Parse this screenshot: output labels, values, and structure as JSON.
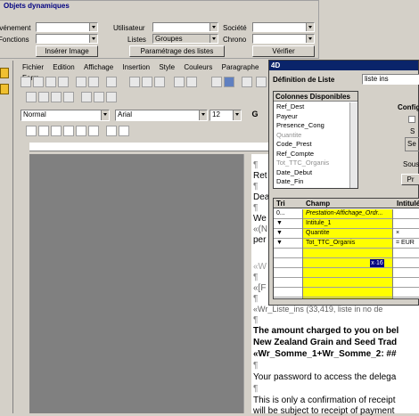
{
  "panel": {
    "title": "Objets dynamiques",
    "evenement_label": "Événement",
    "utilisateur_label": "Utilisateur",
    "societe_label": "Société",
    "fonctions_label": "Fonctions",
    "listes_label": "Listes",
    "listes_value": "Groupes",
    "chrono_label": "Chrono",
    "inserer_image": "Insérer Image",
    "parametrage": "Paramétrage des listes",
    "verifier": "Vérifier"
  },
  "menu": [
    "Fichier",
    "Edition",
    "Affichage",
    "Insertion",
    "Style",
    "Couleurs",
    "Paragraphe",
    "Form"
  ],
  "format": {
    "style": "Normal",
    "font": "Arial",
    "size": "12",
    "bold": "G"
  },
  "document": {
    "lines": [
      "Ret",
      "Dea",
      "We",
      "«(N",
      "per",
      "«W",
      "«[F",
      "«Wr_Liste_ins (33,419, liste in no de",
      "The amount charged to you on bel",
      "New Zealand Grain and Seed Trad",
      "«Wr_Somme_1+Wr_Somme_2: ##",
      "Your password to access the delega",
      "This is only a confirmation of receipt",
      "will be subject to receipt of payment"
    ],
    "pilcrow": "¶"
  },
  "dialog": {
    "icon": "4D",
    "title": "Définition de Liste",
    "name_label": "Définition de Liste",
    "name_value": "liste ins",
    "config_label": "Configu",
    "s_label": "S",
    "se_label": "Se",
    "sous_label": "Sous",
    "pr_label": "Pr",
    "columns_header": "Colonnes Disponibles",
    "columns": [
      "Ref_Dest",
      "Payeur",
      "Presence_Cong",
      "Quantite",
      "Code_Prest",
      "Ref_Compte",
      "Tot_TTC_Organis",
      "Date_Debut",
      "Date_Fin"
    ],
    "columns_disabled": [
      false,
      false,
      false,
      true,
      false,
      false,
      true,
      false,
      false
    ],
    "table_headers": [
      "Tri",
      "Champ",
      "Intitulé"
    ],
    "rows": [
      {
        "tri": "0...",
        "champ": "Prestation-Affichage_Ordr...",
        "intitule": ""
      },
      {
        "tri": "▼",
        "champ": "Intitule_1",
        "intitule": ""
      },
      {
        "tri": "▼",
        "champ": "Quantite",
        "intitule": "×"
      },
      {
        "tri": "▼",
        "champ": "Tot_TTC_Organis",
        "intitule": "= EUR"
      }
    ],
    "selected_cell": "x·16",
    "highlight": "#ffff00",
    "title_bar_color": "#0a246a"
  }
}
